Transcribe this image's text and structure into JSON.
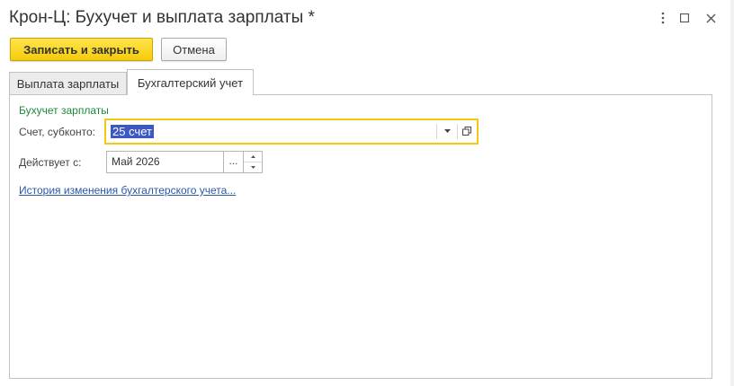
{
  "window": {
    "title": "Крон-Ц: Бухучет и выплата зарплаты *",
    "menu_icon": "more-vert-icon",
    "maximize_icon": "maximize-icon",
    "close_icon": "close-icon"
  },
  "toolbar": {
    "save_close_label": "Записать и закрыть",
    "cancel_label": "Отмена"
  },
  "tabs": [
    {
      "label": "Выплата зарплаты",
      "active": false
    },
    {
      "label": "Бухгалтерский учет",
      "active": true
    }
  ],
  "form": {
    "group_title": "Бухучет зарплаты",
    "account_label": "Счет, субконто:",
    "account_value": "25 счет",
    "effective_label": "Действует с:",
    "effective_value": "Май 2026",
    "date_select_button": "...",
    "history_link": "История изменения бухгалтерского учета..."
  },
  "colors": {
    "primary_button": "#f5cc0a",
    "focus_border": "#f2c811",
    "group_title": "#1d8a3a",
    "link": "#2b57a7",
    "selection": "#3a59c4"
  }
}
